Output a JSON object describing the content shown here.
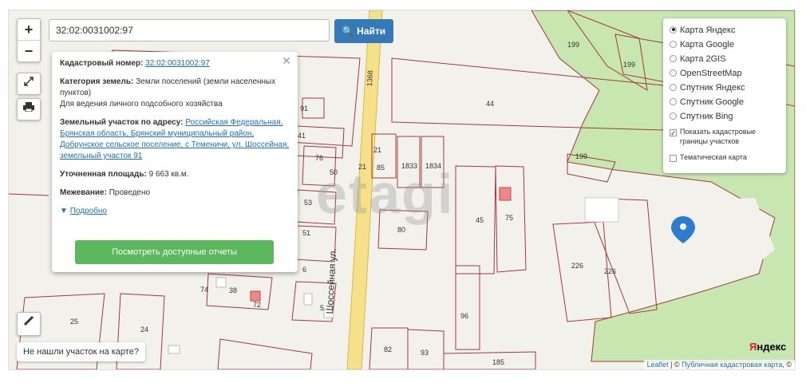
{
  "search": {
    "value": "32:02:0031002:97",
    "button_label": "Найти"
  },
  "zoom": {
    "in_label": "+",
    "out_label": "−"
  },
  "info_popup": {
    "cadastral_label": "Кадастровый номер:",
    "cadastral_value": "32:02:0031002:97",
    "category_label": "Категория земель:",
    "category_value": "Земли поселений (земли населенных пунктов)",
    "purpose": "Для ведения личного подсобного хозяйства",
    "address_label": "Земельный участок по адресу:",
    "address_value": "Российская Федеральная, Брянская область, Брянский муниципальный район, Добрунское сельское поселение, с Теменичи, ул. Шоссейная, земельный участок 91",
    "area_label": "Уточненная площадь:",
    "area_value": "9 663 кв.м.",
    "survey_label": "Межевание:",
    "survey_value": "Проведено",
    "details_link": "Подробно",
    "report_button": "Посмотреть доступные отчеты",
    "close": "✕"
  },
  "layers": {
    "options": [
      "Карта Яндекс",
      "Карта Google",
      "Карта 2GIS",
      "OpenStreetMap",
      "Спутник Яндекс",
      "Спутник Google",
      "Спутник Bing"
    ],
    "selected": 0,
    "show_cadastral": "Показать кадастровые границы участков",
    "thematic": "Тематическая карта"
  },
  "not_found_label": "Не нашли участок на карте?",
  "attribution": {
    "leaflet": "Leaflet",
    "sep": " | © ",
    "pkk": "Публичная кадастровая карта",
    "tail": ", ©"
  },
  "yandex_logo": "Яндекс",
  "watermark": "etagi",
  "map_labels": {
    "road": "Шоссейная ул.",
    "road_num": "1368",
    "parcels": [
      "199",
      "199",
      "199",
      "44",
      "91",
      "41",
      "76",
      "50",
      "85",
      "1833",
      "1834",
      "53",
      "51",
      "6",
      "80",
      "45",
      "75",
      "226",
      "226",
      "74",
      "38",
      "72",
      "5",
      "25",
      "24",
      "96",
      "82",
      "93",
      "185",
      "21",
      "21"
    ]
  },
  "colors": {
    "parcel_stroke": "#a33a3a",
    "forest": "#c8e6b0",
    "road": "#f7e08a",
    "button_blue": "#337ab7",
    "button_green": "#5cb85c",
    "marker": "#2a7dd1"
  }
}
